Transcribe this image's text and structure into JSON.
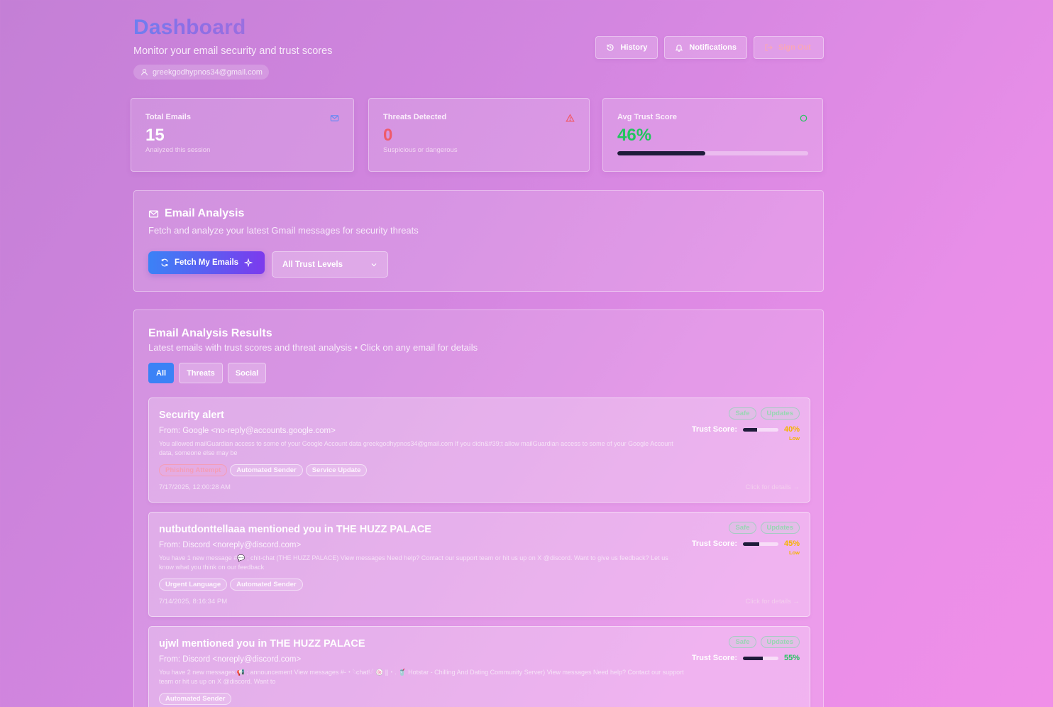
{
  "header": {
    "title": "Dashboard",
    "subtitle": "Monitor your email security and trust scores",
    "user_email": "greekgodhypnos34@gmail.com",
    "actions": [
      {
        "label": "History",
        "icon": "history-icon"
      },
      {
        "label": "Notifications",
        "icon": "bell-icon"
      },
      {
        "label": "Sign Out",
        "icon": "sign-out-icon"
      }
    ]
  },
  "stats": {
    "total": {
      "label": "Total Emails",
      "value": "15",
      "sub": "Analyzed this session"
    },
    "threats": {
      "label": "Threats Detected",
      "value": "0",
      "sub": "Suspicious or dangerous"
    },
    "trust": {
      "label": "Avg Trust Score",
      "value": "46%",
      "fraction": 0.46
    }
  },
  "analysis": {
    "title": "Email Analysis",
    "description": "Fetch and analyze your latest Gmail messages for security threats",
    "fetch_label": "Fetch My Emails",
    "filter_selected": "All Trust Levels"
  },
  "results": {
    "title": "Email Analysis Results",
    "description": "Latest emails with trust scores and threat analysis • Click on any email for details",
    "tabs": [
      "All",
      "Threats",
      "Social"
    ],
    "trust_label": "Trust Score:",
    "details_label": "Click for details →",
    "emails": [
      {
        "subject": "Security alert",
        "from": "From: Google <no-reply@accounts.google.com>",
        "snippet": "You allowed mailGuardian access to some of your Google Account data greekgodhypnos34@gmail.com If you didn&#39;t allow mailGuardian access to some of your Google Account data, someone else may be",
        "tags": [
          "Phishing Attempt",
          "Automated Sender",
          "Service Update"
        ],
        "date": "7/17/2025, 12:00:28 AM",
        "badges": [
          "Safe",
          "Updates"
        ],
        "score": "40%",
        "score_fraction": 0.4,
        "score_color": "#f5b400",
        "risk": "Low"
      },
      {
        "subject": "nutbutdonttellaaa mentioned you in THE HUZZ PALACE",
        "from": "From: Discord <noreply@discord.com>",
        "snippet": "You have 1 new message #💬 ; chit-chat (THE HUZZ PALACE) View messages Need help? Contact our support team or hit us up on X @discord. Want to give us feedback? Let us know what you think on our feedback",
        "tags": [
          "Urgent Language",
          "Automated Sender"
        ],
        "date": "7/14/2025, 8:16:34 PM",
        "badges": [
          "Safe",
          "Updates"
        ],
        "score": "45%",
        "score_fraction": 0.45,
        "score_color": "#f5b400",
        "risk": "Low"
      },
      {
        "subject": "ujwl mentioned you in THE HUZZ PALACE",
        "from": "From: Discord <noreply@discord.com>",
        "snippet": "You have 2 new messages 📢 ; announcement View messages #-・𓆩chat!𓆪 🍥 ||・. 🥤 Hotstar - Chilling And Dating Community Server) View messages Need help? Contact our support team or hit us up on X @discord. Want to",
        "tags": [
          "Automated Sender"
        ],
        "date": "",
        "badges": [
          "Safe",
          "Updates"
        ],
        "score": "55%",
        "score_fraction": 0.55,
        "score_color": "#22c55e",
        "risk": ""
      }
    ]
  },
  "colors": {
    "accent_blue": "#3b82f6",
    "accent_purple": "#7c3aed",
    "threat_red": "#ef5b6b",
    "trust_green": "#22c55e",
    "warning_yellow": "#f5b400"
  }
}
